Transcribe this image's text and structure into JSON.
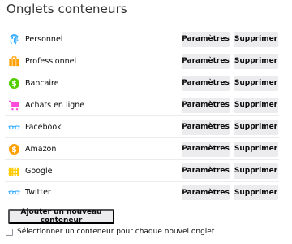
{
  "section": {
    "title": "Onglets conteneurs"
  },
  "containers": [
    {
      "name": "Personnel",
      "icon": "fingerprint-icon",
      "color": "#37adff"
    },
    {
      "name": "Professionnel",
      "icon": "briefcase-icon",
      "color": "#ff9f00"
    },
    {
      "name": "Bancaire",
      "icon": "dollar-icon",
      "color": "#51cd00"
    },
    {
      "name": "Achats en ligne",
      "icon": "cart-icon",
      "color": "#ff4bda"
    },
    {
      "name": "Facebook",
      "icon": "glasses-icon",
      "color": "#37adff"
    },
    {
      "name": "Amazon",
      "icon": "dollar-icon",
      "color": "#ff9f00"
    },
    {
      "name": "Google",
      "icon": "fence-icon",
      "color": "#ffcb00"
    },
    {
      "name": "Twitter",
      "icon": "glasses-icon",
      "color": "#37adff"
    }
  ],
  "buttons": {
    "params_label": "Paramètres",
    "delete_label": "Supprimer",
    "add_label": "Ajouter un nouveau conteneur"
  },
  "option": {
    "label": "Sélectionner un conteneur pour chaque nouvel onglet",
    "checked": false
  }
}
